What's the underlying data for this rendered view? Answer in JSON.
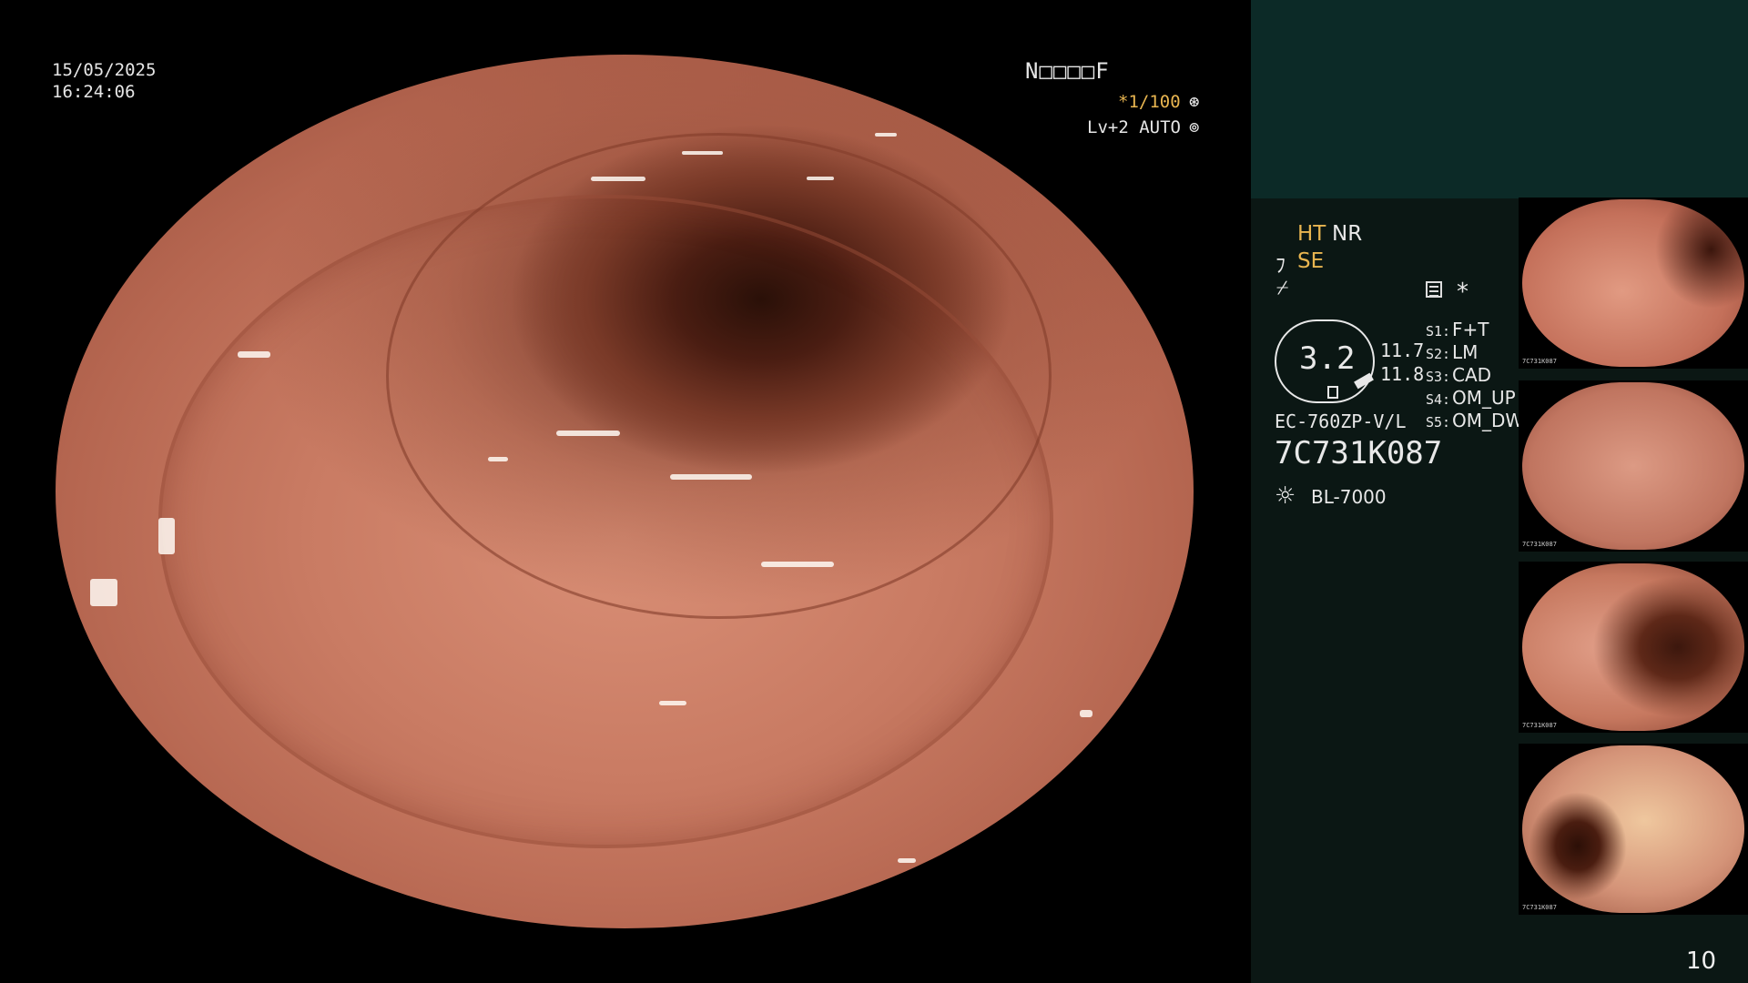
{
  "overlay": {
    "date": "15/05/2025",
    "time": "16:24:06",
    "top_code": "N□□□□F",
    "shutter": "*1/100",
    "shutter_icon": "⊛",
    "level": "Lv+2 AUTO",
    "level_icon": "⊚"
  },
  "panel": {
    "ht": "HT",
    "nr": "NR",
    "se_icon": "ﾌ",
    "se": "SE",
    "fe_icon": "⌿",
    "star": "*",
    "zoom": "3.2",
    "measure_1": "11.7",
    "measure_2": "11.8",
    "settings": [
      {
        "key": "S1:",
        "value": "F+T"
      },
      {
        "key": "S2:",
        "value": "LM"
      },
      {
        "key": "S3:",
        "value": "CAD"
      },
      {
        "key": "S4:",
        "value": "OM_UP"
      },
      {
        "key": "S5:",
        "value": "OM_DW"
      }
    ],
    "scope_model": "EC-760ZP-V/L",
    "serial": "7C731K087",
    "light_icon": "☼",
    "light_source": "BL-7000"
  },
  "thumbnails": [
    {
      "label": "7C731K087"
    },
    {
      "label": "7C731K087"
    },
    {
      "label": "7C731K087"
    },
    {
      "label": "7C731K087"
    }
  ],
  "page_number": "10",
  "colors": {
    "accent_orange": "#e8b550",
    "panel_bg": "#0b1714",
    "panel_top_bg": "#0c2a27"
  }
}
